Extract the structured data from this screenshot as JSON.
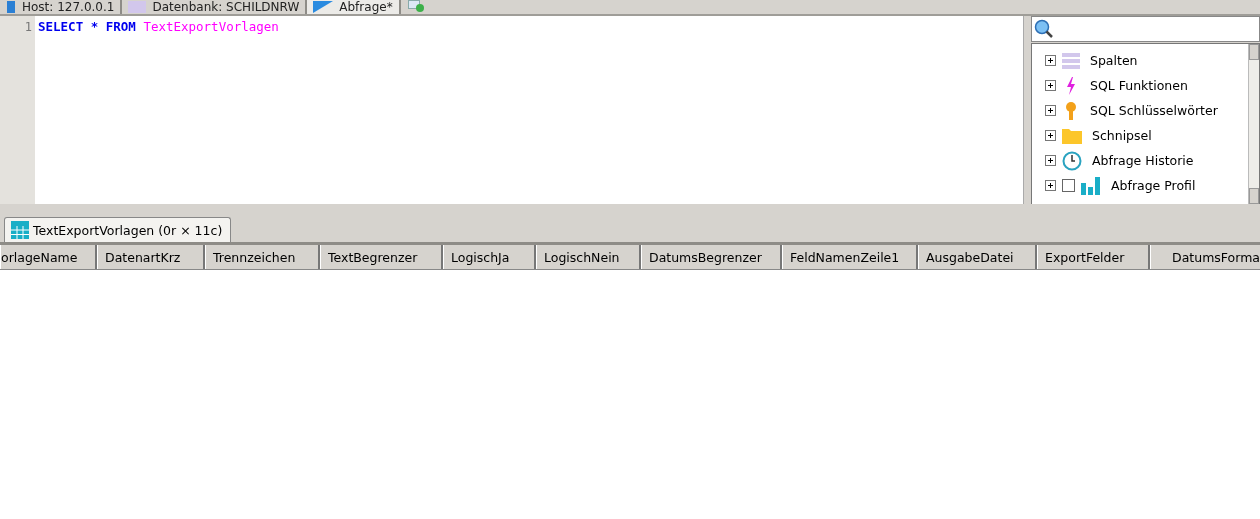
{
  "top_tabs": [
    {
      "label": "Host: 127.0.0.1",
      "kind": "host",
      "selected": false
    },
    {
      "label": "Datenbank: SCHILDNRW",
      "kind": "database",
      "selected": false
    },
    {
      "label": "Abfrage*",
      "kind": "query",
      "selected": true
    }
  ],
  "editor": {
    "line_number": "1",
    "tokens": [
      {
        "text": "SELECT",
        "kind": "keyword"
      },
      {
        "text": "*",
        "kind": "operator"
      },
      {
        "text": "FROM",
        "kind": "keyword"
      },
      {
        "text": "TextExportVorlagen",
        "kind": "identifier"
      }
    ]
  },
  "helper_tree": {
    "items": [
      {
        "label": "Spalten",
        "kind": "columns",
        "expanded": false
      },
      {
        "label": "SQL Funktionen",
        "kind": "function",
        "expanded": false
      },
      {
        "label": "SQL Schlüsselwörter",
        "kind": "key",
        "expanded": false
      },
      {
        "label": "Schnipsel",
        "kind": "folder",
        "expanded": false
      },
      {
        "label": "Abfrage Historie",
        "kind": "clock",
        "expanded": false
      },
      {
        "label": "Abfrage Profil",
        "kind": "chart",
        "expanded": false,
        "checked": false
      }
    ]
  },
  "result_tab": {
    "label": "TextExportVorlagen (0r × 11c)"
  },
  "table": {
    "columns": [
      "orlageName",
      "DatenartKrz",
      "Trennzeichen",
      "TextBegrenzer",
      "LogischJa",
      "LogischNein",
      "DatumsBegrenzer",
      "FeldNamenZeile1",
      "AusgabeDatei",
      "ExportFelder",
      "DatumsForma"
    ]
  }
}
